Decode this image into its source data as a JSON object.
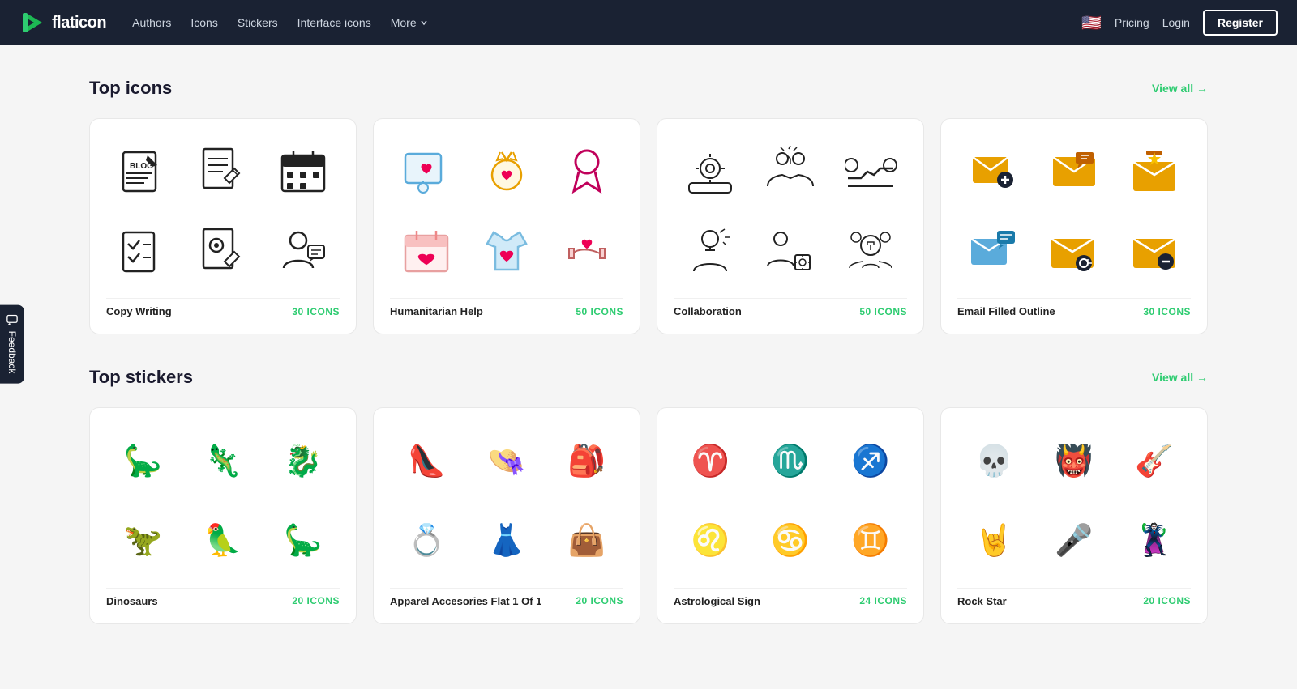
{
  "nav": {
    "logo_text": "flaticon",
    "links": [
      {
        "label": "Authors",
        "id": "authors"
      },
      {
        "label": "Icons",
        "id": "icons"
      },
      {
        "label": "Stickers",
        "id": "stickers"
      },
      {
        "label": "Interface icons",
        "id": "interface-icons"
      },
      {
        "label": "More",
        "id": "more",
        "has_dropdown": true
      }
    ],
    "pricing_label": "Pricing",
    "login_label": "Login",
    "register_label": "Register"
  },
  "top_icons": {
    "section_title": "Top icons",
    "view_all_label": "View all →",
    "cards": [
      {
        "id": "copy-writing",
        "name": "Copy Writing",
        "count": "30 ICONS"
      },
      {
        "id": "humanitarian-help",
        "name": "Humanitarian Help",
        "count": "50 ICONS"
      },
      {
        "id": "collaboration",
        "name": "Collaboration",
        "count": "50 ICONS"
      },
      {
        "id": "email-filled-outline",
        "name": "Email Filled Outline",
        "count": "30 ICONS"
      }
    ]
  },
  "top_stickers": {
    "section_title": "Top stickers",
    "view_all_label": "View all →",
    "cards": [
      {
        "id": "dinosaurs",
        "name": "Dinosaurs",
        "count": "20 ICONS"
      },
      {
        "id": "apparel-accessories",
        "name": "Apparel Accesories Flat 1 Of 1",
        "count": "20 ICONS"
      },
      {
        "id": "astrological-sign",
        "name": "Astrological Sign",
        "count": "24 ICONS"
      },
      {
        "id": "rock-star",
        "name": "Rock Star",
        "count": "20 ICONS"
      }
    ]
  },
  "feedback": {
    "label": "Feedback"
  },
  "colors": {
    "accent": "#2ecc71",
    "nav_bg": "#1a2233"
  }
}
